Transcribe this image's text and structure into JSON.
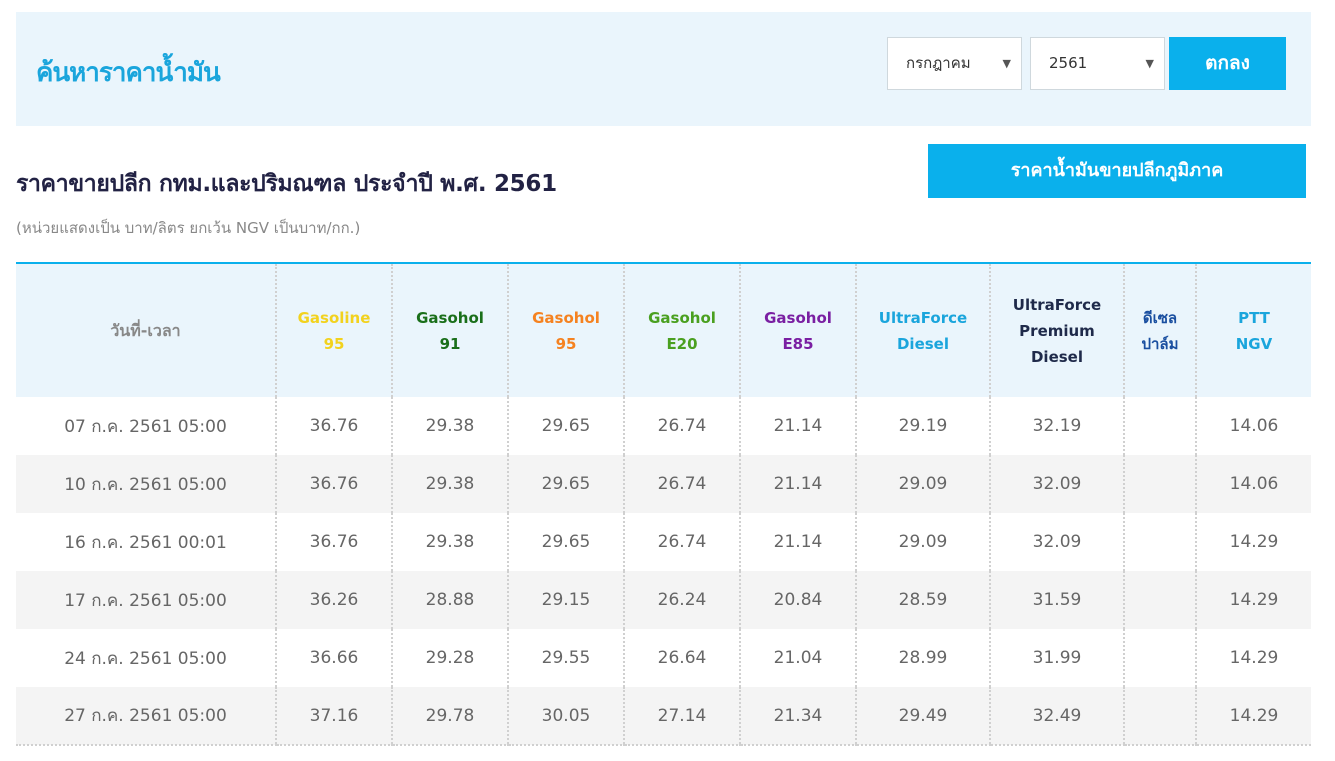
{
  "search": {
    "title": "ค้นหาราคาน้ำมัน",
    "month_value": "กรกฎาคม",
    "year_value": "2561",
    "submit_label": "ตกลง"
  },
  "page": {
    "title": "ราคาขายปลีก กทม.และปริมณฑล ประจำปี พ.ศ. 2561",
    "unit_note": "(หน่วยแสดงเป็น บาท/ลิตร ยกเว้น NGV เป็นบาท/กก.)",
    "regional_button": "ราคาน้ำมันขายปลีกภูมิภาค"
  },
  "table": {
    "columns": [
      {
        "lines": [
          "วันที่-เวลา"
        ],
        "color": "#888888"
      },
      {
        "lines": [
          "Gasoline",
          "95"
        ],
        "color": "#f2d21e"
      },
      {
        "lines": [
          "Gasohol",
          "91"
        ],
        "color": "#1a6f1a"
      },
      {
        "lines": [
          "Gasohol",
          "95"
        ],
        "color": "#f58220"
      },
      {
        "lines": [
          "Gasohol",
          "E20"
        ],
        "color": "#4aa020"
      },
      {
        "lines": [
          "Gasohol",
          "E85"
        ],
        "color": "#7a1fa2"
      },
      {
        "lines": [
          "UltraForce",
          "Diesel"
        ],
        "color": "#1aa5dc"
      },
      {
        "lines": [
          "UltraForce",
          "Premium",
          "Diesel"
        ],
        "color": "#1f2a4a"
      },
      {
        "lines": [
          "ดีเซล",
          "ปาล์ม"
        ],
        "color": "#1a4fa0"
      },
      {
        "lines": [
          "PTT",
          "NGV"
        ],
        "color": "#1aa5dc"
      }
    ],
    "rows": [
      [
        "07 ก.ค. 2561 05:00",
        "36.76",
        "29.38",
        "29.65",
        "26.74",
        "21.14",
        "29.19",
        "32.19",
        "",
        "14.06"
      ],
      [
        "10 ก.ค. 2561 05:00",
        "36.76",
        "29.38",
        "29.65",
        "26.74",
        "21.14",
        "29.09",
        "32.09",
        "",
        "14.06"
      ],
      [
        "16 ก.ค. 2561 00:01",
        "36.76",
        "29.38",
        "29.65",
        "26.74",
        "21.14",
        "29.09",
        "32.09",
        "",
        "14.29"
      ],
      [
        "17 ก.ค. 2561 05:00",
        "36.26",
        "28.88",
        "29.15",
        "26.24",
        "20.84",
        "28.59",
        "31.59",
        "",
        "14.29"
      ],
      [
        "24 ก.ค. 2561 05:00",
        "36.66",
        "29.28",
        "29.55",
        "26.64",
        "21.04",
        "28.99",
        "31.99",
        "",
        "14.29"
      ],
      [
        "27 ก.ค. 2561 05:00",
        "37.16",
        "29.78",
        "30.05",
        "27.14",
        "21.34",
        "29.49",
        "32.49",
        "",
        "14.29"
      ]
    ]
  }
}
